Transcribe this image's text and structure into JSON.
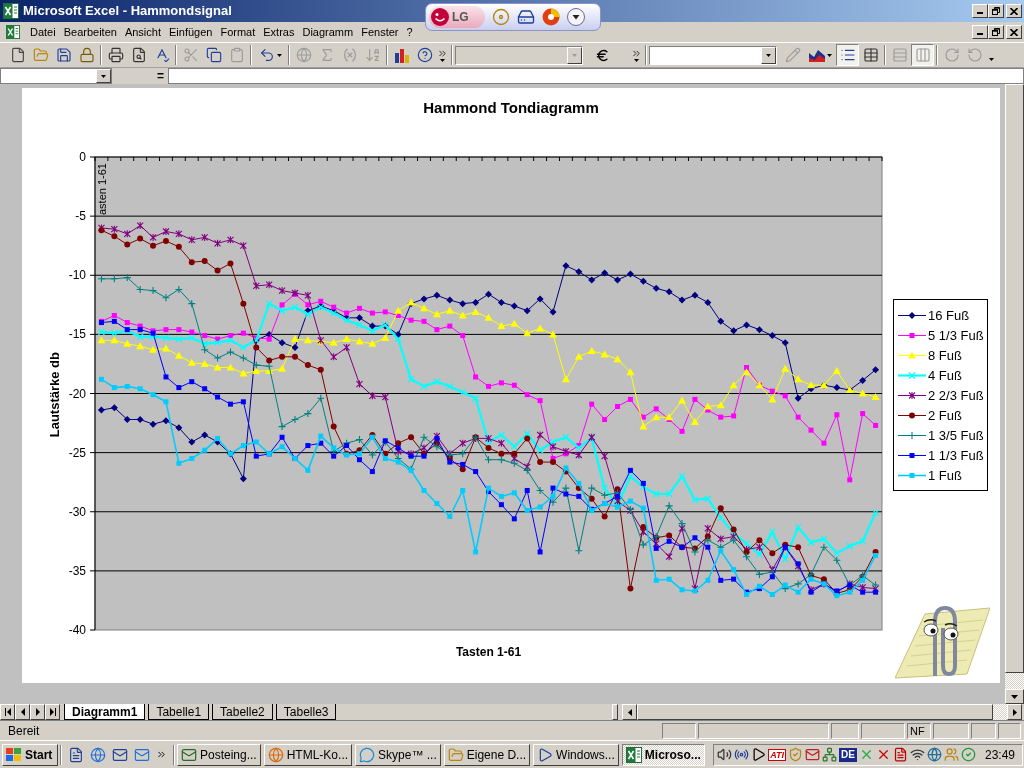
{
  "window": {
    "title": "Microsoft Excel - Hammondsignal"
  },
  "overlay_toolbar": {
    "logo": "LG"
  },
  "menu_bar": {
    "items": [
      "Datei",
      "Bearbeiten",
      "Ansicht",
      "Einfügen",
      "Format",
      "Extras",
      "Diagramm",
      "Fenster",
      "?"
    ]
  },
  "standard_toolbar": {
    "buttons": [
      {
        "disabled": false
      },
      {
        "disabled": false
      },
      {
        "disabled": false
      },
      {
        "disabled": false
      },
      {
        "disabled": false
      },
      {
        "disabled": false
      },
      {
        "disabled": false
      },
      {
        "disabled": true
      },
      {
        "disabled": false
      },
      {
        "disabled": true
      },
      {
        "disabled": false
      },
      {
        "disabled": true
      },
      {
        "disabled": true
      },
      {
        "disabled": true
      },
      {
        "disabled": true
      },
      {
        "disabled": false
      },
      {
        "disabled": false
      },
      {
        "disabled": false
      }
    ],
    "font_box": {
      "disabled": true
    }
  },
  "chart_toolbar": {
    "object_box": {
      "disabled": false
    },
    "buttons": [
      {
        "pressed": false,
        "disabled": true
      },
      {
        "pressed": false,
        "disabled": false
      },
      {
        "pressed": true,
        "disabled": false
      },
      {
        "pressed": false,
        "disabled": false
      },
      {
        "pressed": false,
        "disabled": true
      },
      {
        "pressed": true,
        "disabled": true
      },
      {
        "pressed": false,
        "disabled": true
      },
      {
        "pressed": false,
        "disabled": true
      }
    ]
  },
  "formula_bar": {
    "equals": "="
  },
  "chart": {
    "chart_data": {
      "type": "line",
      "title": "Hammond Tondiagramm",
      "xlabel": "Tasten 1-61",
      "ylabel": "Lautstärke db",
      "ylim": [
        -40,
        0
      ],
      "yticks": [
        0,
        -5,
        -10,
        -15,
        -20,
        -25,
        -30,
        -35,
        -40
      ],
      "grid": true,
      "legend": true,
      "annotations": [
        {
          "text": "asten 1-61"
        }
      ],
      "series": [
        {
          "name": "16 Fuß",
          "color": "#000080",
          "marker": "diamond",
          "values": [
            -21.4,
            -21.2,
            -22.2,
            -22.2,
            -22.6,
            -22.3,
            -22.9,
            -24.1,
            -23.5,
            -24.1,
            -25.1,
            -27.2,
            -15.5,
            -15.0,
            -15.7,
            -16.1,
            -13.0,
            -12.6,
            -13.0,
            -13.6,
            -13.6,
            -14.3,
            -14.3,
            -15.0,
            -12.4,
            -12.0,
            -11.7,
            -12.1,
            -12.4,
            -12.3,
            -11.6,
            -12.3,
            -12.6,
            -13.0,
            -12.0,
            -13.1,
            -9.2,
            -9.7,
            -10.4,
            -9.8,
            -10.4,
            -9.9,
            -10.5,
            -11.1,
            -11.4,
            -12.1,
            -11.7,
            -12.3,
            -13.9,
            -14.7,
            -14.2,
            -14.6,
            -15.1,
            -15.7,
            -20.4,
            -19.6,
            -19.3,
            -19.5,
            -19.7,
            -18.9,
            -18.0
          ]
        },
        {
          "name": "5 1/3 Fuß",
          "color": "#ff00ff",
          "marker": "square",
          "values": [
            -13.9,
            -13.4,
            -14.0,
            -14.3,
            -14.7,
            -14.6,
            -14.6,
            -14.8,
            -15.1,
            -15.4,
            -15.1,
            -14.9,
            -15.3,
            -15.4,
            -12.5,
            -11.6,
            -12.5,
            -12.2,
            -12.7,
            -13.2,
            -12.8,
            -13.2,
            -13.1,
            -13.4,
            -13.8,
            -13.9,
            -14.6,
            -14.3,
            -15.1,
            -18.6,
            -19.4,
            -19.1,
            -19.3,
            -20.1,
            -20.6,
            -25.5,
            -25.1,
            -24.4,
            -20.9,
            -22.2,
            -21.1,
            -20.5,
            -22.0,
            -21.3,
            -22.2,
            -23.2,
            -20.5,
            -21.4,
            -22.0,
            -21.9,
            -17.8,
            -19.3,
            -19.8,
            -20.2,
            -22.0,
            -23.1,
            -24.2,
            -21.8,
            -27.3,
            -21.7,
            -22.7
          ]
        },
        {
          "name": "8 Fuß",
          "color": "#ffff00",
          "marker": "triangle",
          "values": [
            -15.5,
            -15.5,
            -15.8,
            -16.0,
            -16.3,
            -16.2,
            -16.8,
            -17.4,
            -17.5,
            -17.8,
            -17.8,
            -18.3,
            -18.1,
            -18.1,
            -17.9,
            -15.4,
            -15.5,
            -15.6,
            -15.7,
            -15.4,
            -15.6,
            -15.8,
            -15.3,
            -13.0,
            -12.3,
            -12.8,
            -13.3,
            -13.0,
            -13.4,
            -13.1,
            -13.6,
            -14.3,
            -14.1,
            -14.9,
            -14.5,
            -15.0,
            -18.8,
            -16.9,
            -16.4,
            -16.7,
            -17.1,
            -18.2,
            -22.8,
            -22.0,
            -22.0,
            -20.6,
            -22.4,
            -21.1,
            -21.0,
            -19.3,
            -18.2,
            -19.3,
            -20.5,
            -17.9,
            -18.8,
            -19.3,
            -19.3,
            -18.1,
            -19.7,
            -20.0,
            -20.3
          ]
        },
        {
          "name": "4 Fuß",
          "color": "#00ffff",
          "marker": "x",
          "values": [
            -14.8,
            -14.9,
            -14.7,
            -15.2,
            -15.2,
            -15.3,
            -15.4,
            -15.3,
            -15.8,
            -15.7,
            -15.5,
            -16.1,
            -15.5,
            -12.4,
            -13.0,
            -12.7,
            -13.3,
            -12.7,
            -13.2,
            -13.8,
            -14.2,
            -14.7,
            -14.2,
            -15.4,
            -18.8,
            -19.4,
            -19.0,
            -19.4,
            -19.9,
            -20.4,
            -24.1,
            -23.5,
            -24.5,
            -23.4,
            -24.8,
            -24.1,
            -23.7,
            -24.6,
            -23.8,
            -28.0,
            -29.5,
            -27.0,
            -27.9,
            -28.5,
            -28.5,
            -27.0,
            -29.0,
            -28.9,
            -30.5,
            -31.8,
            -32.7,
            -33.6,
            -31.7,
            -34.0,
            -31.3,
            -32.6,
            -32.3,
            -33.5,
            -32.9,
            -32.5,
            -30.1
          ]
        },
        {
          "name": "2 2/3 Fuß",
          "color": "#800080",
          "marker": "cross",
          "values": [
            -6.0,
            -6.1,
            -6.5,
            -5.8,
            -6.8,
            -6.3,
            -6.5,
            -7.0,
            -6.8,
            -7.3,
            -7.0,
            -7.5,
            -10.9,
            -10.8,
            -11.3,
            -11.5,
            -11.7,
            -15.5,
            -16.9,
            -16.1,
            -19.2,
            -20.2,
            -20.3,
            -24.9,
            -25.1,
            -24.6,
            -23.6,
            -25.1,
            -24.2,
            -23.8,
            -23.8,
            -24.2,
            -25.5,
            -26.2,
            -23.5,
            -24.5,
            -24.9,
            -25.2,
            -23.7,
            -25.3,
            -29.1,
            -29.9,
            -31.7,
            -32.7,
            -33.8,
            -31.4,
            -36.5,
            -31.4,
            -32.3,
            -32.1,
            -33.2,
            -33.0,
            -34.9,
            -33.0,
            -34.6,
            -36.6,
            -36.1,
            -36.8,
            -36.1,
            -36.4,
            -36.5
          ]
        },
        {
          "name": "2 Fuß",
          "color": "#800000",
          "marker": "circle",
          "values": [
            -6.2,
            -6.7,
            -7.4,
            -6.9,
            -7.5,
            -7.1,
            -7.6,
            -8.9,
            -8.8,
            -9.6,
            -9.0,
            -12.4,
            -16.1,
            -17.2,
            -16.9,
            -16.9,
            -17.6,
            -18.0,
            -22.8,
            -25.1,
            -24.8,
            -23.5,
            -25.1,
            -24.2,
            -23.7,
            -25.1,
            -24.2,
            -25.5,
            -26.4,
            -23.7,
            -24.6,
            -25.1,
            -25.1,
            -23.8,
            -25.8,
            -25.8,
            -26.6,
            -28.0,
            -28.9,
            -30.4,
            -28.1,
            -36.5,
            -31.3,
            -32.2,
            -32.0,
            -33.0,
            -33.1,
            -32.1,
            -29.7,
            -31.5,
            -33.4,
            -32.4,
            -33.5,
            -32.8,
            -33.0,
            -35.4,
            -35.7,
            -36.9,
            -36.6,
            -35.5,
            -33.4
          ]
        },
        {
          "name": "1 3/5 Fuß",
          "color": "#008080",
          "marker": "plus",
          "values": [
            -10.3,
            -10.3,
            -10.2,
            -11.2,
            -11.3,
            -11.9,
            -11.2,
            -12.4,
            -16.3,
            -17.0,
            -16.5,
            -17.0,
            -17.6,
            -17.7,
            -22.8,
            -22.2,
            -21.7,
            -20.4,
            -24.9,
            -24.2,
            -23.9,
            -25.2,
            -24.1,
            -25.5,
            -26.4,
            -23.7,
            -24.5,
            -25.2,
            -25.1,
            -23.7,
            -25.6,
            -25.6,
            -25.9,
            -26.5,
            -28.2,
            -29.2,
            -28.0,
            -33.3,
            -28.0,
            -28.6,
            -28.4,
            -29.8,
            -32.8,
            -32.1,
            -29.5,
            -31.0,
            -33.4,
            -32.4,
            -33.0,
            -32.4,
            -33.8,
            -35.3,
            -35.1,
            -36.5,
            -36.1,
            -35.3,
            -33.0,
            -34.1,
            -36.2,
            -35.4,
            -36.2
          ]
        },
        {
          "name": "1 1/3 Fuß",
          "color": "#0000ff",
          "marker": "square",
          "values": [
            -14.0,
            -13.9,
            -14.6,
            -14.6,
            -14.9,
            -18.6,
            -19.5,
            -19.0,
            -19.6,
            -20.3,
            -20.9,
            -20.7,
            -25.3,
            -25.1,
            -23.7,
            -25.5,
            -24.4,
            -24.2,
            -25.3,
            -24.4,
            -25.6,
            -26.6,
            -24.0,
            -24.6,
            -25.3,
            -25.3,
            -23.8,
            -25.8,
            -26.0,
            -26.6,
            -28.3,
            -29.4,
            -30.6,
            -28.2,
            -33.4,
            -28.0,
            -28.5,
            -28.7,
            -29.8,
            -29.3,
            -28.7,
            -26.5,
            -27.6,
            -33.1,
            -32.5,
            -33.0,
            -32.2,
            -33.0,
            -35.8,
            -35.7,
            -36.8,
            -36.5,
            -35.5,
            -33.0,
            -34.4,
            -36.8,
            -36.1,
            -36.7,
            -36.2,
            -36.8,
            -36.8
          ]
        },
        {
          "name": "1 Fuß",
          "color": "#00ccff",
          "marker": "square",
          "values": [
            -18.8,
            -19.5,
            -19.4,
            -19.6,
            -20.1,
            -20.7,
            -25.9,
            -25.5,
            -24.8,
            -23.8,
            -25.1,
            -24.4,
            -24.1,
            -25.1,
            -24.5,
            -25.5,
            -26.5,
            -23.6,
            -24.6,
            -25.2,
            -25.1,
            -23.7,
            -25.5,
            -25.8,
            -26.5,
            -28.2,
            -29.3,
            -30.4,
            -28.2,
            -33.4,
            -28.0,
            -28.7,
            -28.4,
            -29.9,
            -29.6,
            -28.7,
            -26.3,
            -27.6,
            -29.9,
            -29.3,
            -29.6,
            -29.1,
            -29.7,
            -35.8,
            -35.7,
            -36.6,
            -36.7,
            -35.8,
            -33.3,
            -34.9,
            -37.0,
            -36.3,
            -37.0,
            -36.2,
            -36.8,
            -35.7,
            -36.1,
            -37.1,
            -36.8,
            -35.8,
            -33.7
          ]
        }
      ]
    }
  },
  "sheet_tabs": [
    {
      "label": "Diagramm1",
      "selected": true
    },
    {
      "label": "Tabelle1",
      "selected": false
    },
    {
      "label": "Tabelle2",
      "selected": false
    },
    {
      "label": "Tabelle3",
      "selected": false
    }
  ],
  "status_bar": {
    "text": "Bereit",
    "indicator": "NF"
  },
  "taskbar": {
    "start": "Start",
    "tasks": [
      {
        "label": "Posteing...",
        "selected": false
      },
      {
        "label": "HTML-Ko...",
        "selected": false
      },
      {
        "label": "Skype™ ...",
        "selected": false
      },
      {
        "label": "Eigene D...",
        "selected": false
      },
      {
        "label": "Windows...",
        "selected": false
      },
      {
        "label": "Microso...",
        "selected": true
      }
    ],
    "tray": {
      "vendor_badge": "ATI",
      "language": "DE",
      "clock": "23:49"
    }
  }
}
